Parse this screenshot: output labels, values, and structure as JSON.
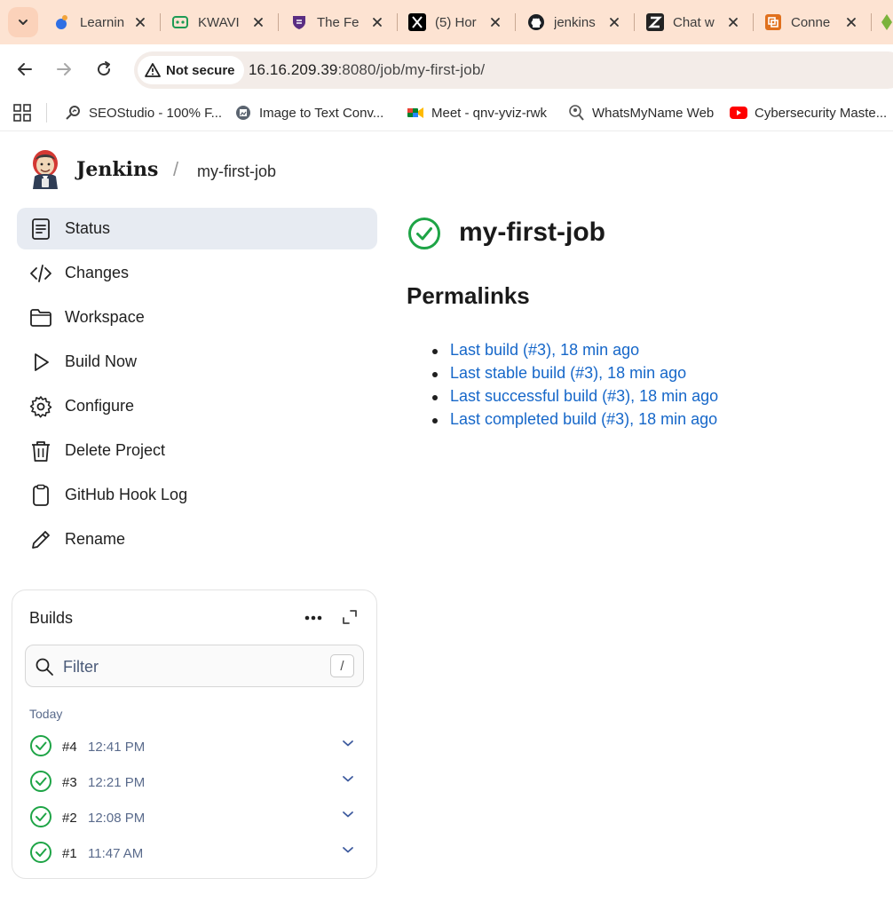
{
  "browser": {
    "tabs": [
      {
        "title": "Learnin",
        "icon": "learning-app-icon"
      },
      {
        "title": "KWAVI",
        "icon": "kwavi-icon"
      },
      {
        "title": "The Fe",
        "icon": "shield-crest-icon"
      },
      {
        "title": "(5) Hor",
        "icon": "x-logo-icon"
      },
      {
        "title": "jenkins",
        "icon": "github-icon"
      },
      {
        "title": "Chat w",
        "icon": "zapier-z-icon"
      },
      {
        "title": "Conne",
        "icon": "connect-app-icon"
      }
    ],
    "security_label": "Not secure",
    "url_host": "16.16.209.39",
    "url_rest": ":8080/job/my-first-job/",
    "bookmarks": [
      {
        "label": "SEOStudio - 100% F...",
        "icon": "seo-icon"
      },
      {
        "label": "Image to Text Conv...",
        "icon": "image-convert-icon"
      },
      {
        "label": "Meet - qnv-yviz-rwk",
        "icon": "google-meet-icon"
      },
      {
        "label": "WhatsMyName Web",
        "icon": "whatsmyname-icon"
      },
      {
        "label": "Cybersecurity Maste...",
        "icon": "youtube-icon"
      }
    ]
  },
  "jenkins": {
    "brand": "Jenkins",
    "breadcrumb": "my-first-job",
    "sidebar": [
      {
        "label": "Status",
        "icon": "document-icon"
      },
      {
        "label": "Changes",
        "icon": "code-icon"
      },
      {
        "label": "Workspace",
        "icon": "folder-icon"
      },
      {
        "label": "Build Now",
        "icon": "play-icon"
      },
      {
        "label": "Configure",
        "icon": "gear-icon"
      },
      {
        "label": "Delete Project",
        "icon": "trash-icon"
      },
      {
        "label": "GitHub Hook Log",
        "icon": "clipboard-icon"
      },
      {
        "label": "Rename",
        "icon": "pencil-icon"
      }
    ],
    "builds": {
      "title": "Builds",
      "filter_placeholder": "Filter",
      "filter_shortcut": "/",
      "day": "Today",
      "items": [
        {
          "number": "#4",
          "time": "12:41 PM"
        },
        {
          "number": "#3",
          "time": "12:21 PM"
        },
        {
          "number": "#2",
          "time": "12:08 PM"
        },
        {
          "number": "#1",
          "time": "11:47 AM"
        }
      ]
    },
    "job_title": "my-first-job",
    "permalinks_title": "Permalinks",
    "permalinks": [
      "Last build (#3), 18 min ago",
      "Last stable build (#3), 18 min ago",
      "Last successful build (#3), 18 min ago",
      "Last completed build (#3), 18 min ago"
    ],
    "colors": {
      "success": "#1ea446",
      "link": "#1667c9",
      "active_bg": "#e7ebf2"
    }
  }
}
